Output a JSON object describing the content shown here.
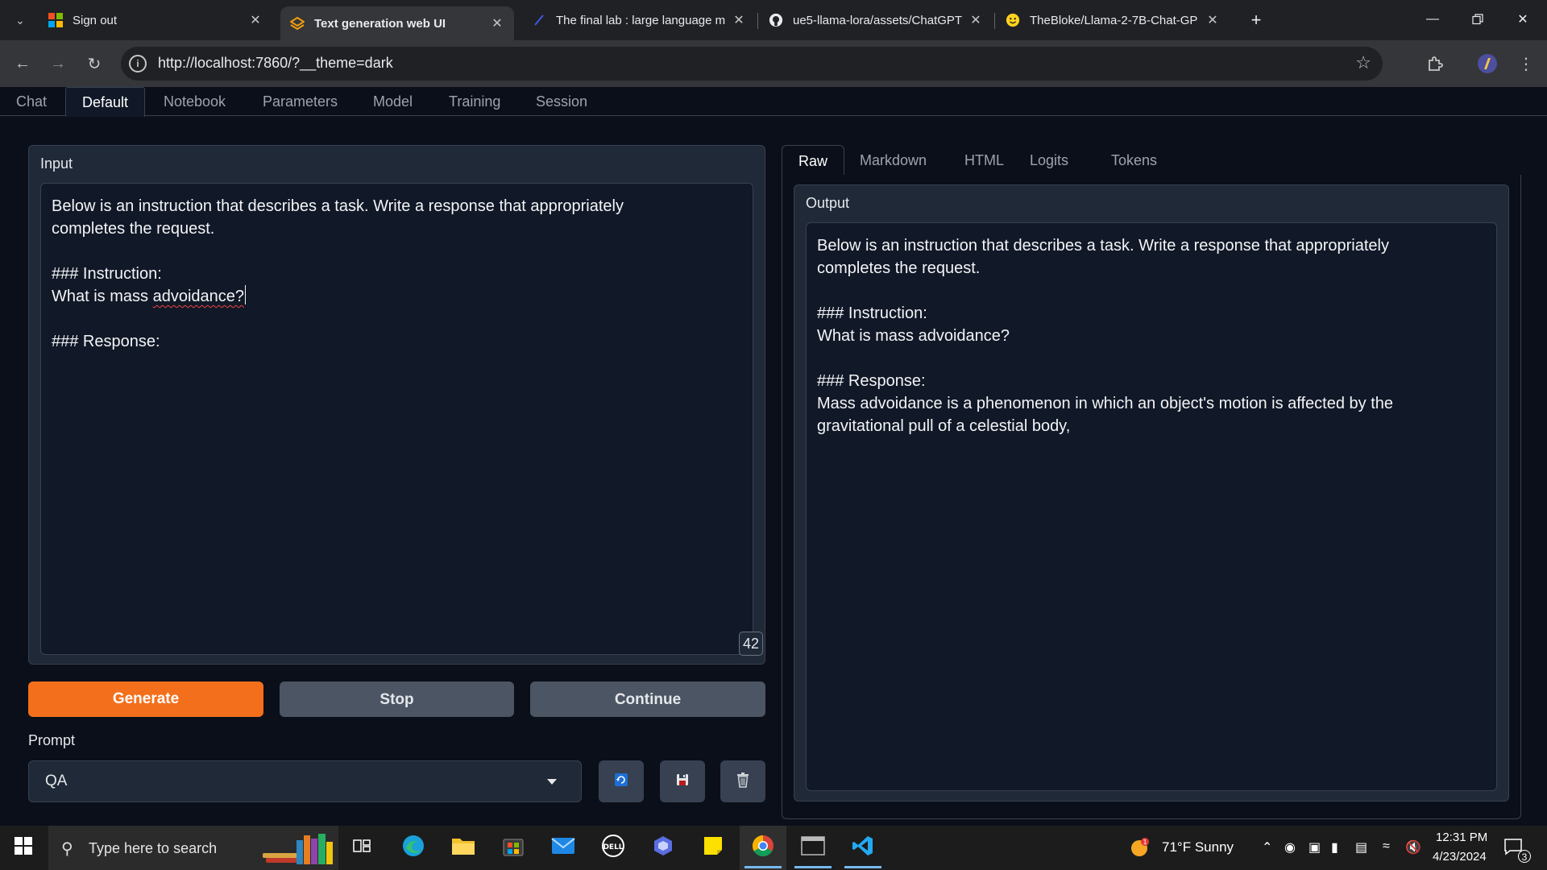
{
  "browser": {
    "tabs": [
      {
        "title": "Sign out",
        "icon": "microsoft-logo",
        "active": false
      },
      {
        "title": "Text generation web UI",
        "icon": "textgen-logo",
        "active": true
      },
      {
        "title": "The final lab : large language m",
        "icon": "page-icon",
        "active": false
      },
      {
        "title": "ue5-llama-lora/assets/ChatGPT",
        "icon": "github-icon",
        "active": false
      },
      {
        "title": "TheBloke/Llama-2-7B-Chat-GP",
        "icon": "huggingface-icon",
        "active": false
      }
    ],
    "url": "http://localhost:7860/?__theme=dark"
  },
  "app": {
    "main_tabs": [
      "Chat",
      "Default",
      "Notebook",
      "Parameters",
      "Model",
      "Training",
      "Session"
    ],
    "active_main_tab": "Default",
    "input": {
      "label": "Input",
      "line1": "Below is an instruction that describes a task. Write a response that appropriately",
      "line2": "completes the request.",
      "line3": "### Instruction:",
      "line4_pre": "What is mass ",
      "line4_word": "advoidance?",
      "line5": "### Response:",
      "token_count": "42"
    },
    "buttons": {
      "generate": "Generate",
      "stop": "Stop",
      "continue": "Continue"
    },
    "prompt": {
      "label": "Prompt",
      "value": "QA"
    },
    "output_tabs": [
      "Raw",
      "Markdown",
      "HTML",
      "Logits",
      "Tokens"
    ],
    "active_output_tab": "Raw",
    "output": {
      "label": "Output",
      "text": "Below is an instruction that describes a task. Write a response that appropriately\ncompletes the request.\n\n### Instruction:\nWhat is mass advoidance?\n\n### Response:\nMass advoidance is a phenomenon in which an object's motion is affected by the\ngravitational pull of a celestial body,"
    }
  },
  "taskbar": {
    "search_placeholder": "Type here to search",
    "weather": "71°F  Sunny",
    "time": "12:31 PM",
    "date": "4/23/2024",
    "notifications": "3"
  },
  "colors": {
    "accent": "#f36f1b",
    "background": "#0b0f19",
    "panel": "#1f2937"
  }
}
